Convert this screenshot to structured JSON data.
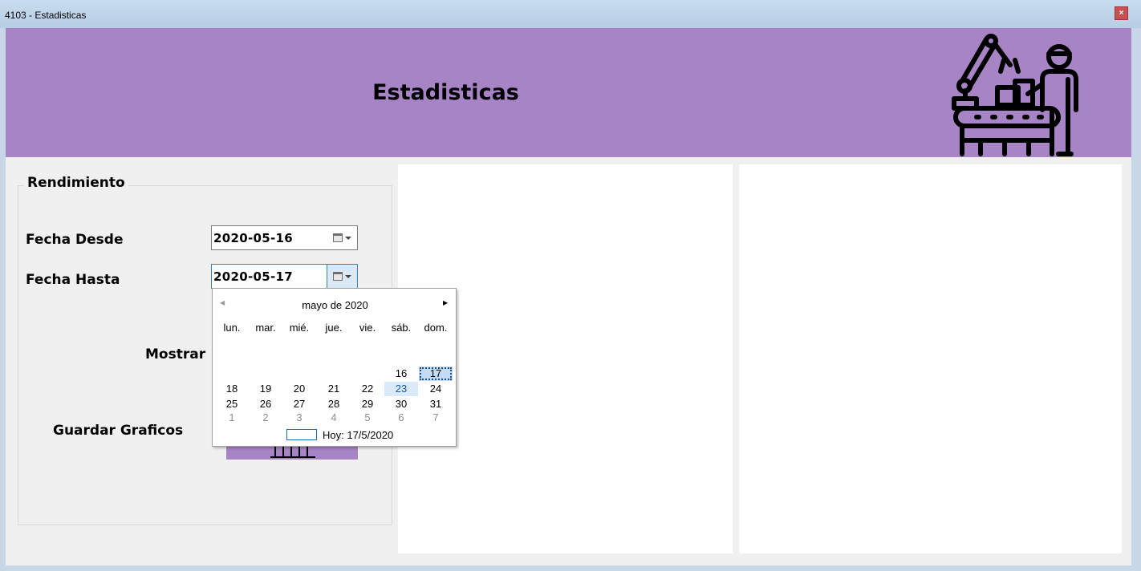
{
  "window": {
    "title": "4103 - Estadisticas",
    "close_glyph": "×",
    "close_color": "#c75050"
  },
  "header": {
    "title": "Estadisticas",
    "background": "#a684c6",
    "icon": "factory-worker-icon"
  },
  "rendimiento": {
    "title": "Rendimiento",
    "fecha_desde": {
      "label": "Fecha Desde",
      "value": "2020-05-16"
    },
    "fecha_hasta": {
      "label": "Fecha Hasta",
      "value": "2020-05-17"
    },
    "mostrar_label": "Mostrar",
    "guardar_label": "Guardar Graficos"
  },
  "calendar": {
    "month_title": "mayo de 2020",
    "prev_glyph": "◀",
    "next_glyph": "▶",
    "weekdays": [
      "lun.",
      "mar.",
      "mié.",
      "jue.",
      "vie.",
      "sáb.",
      "dom."
    ],
    "weeks": [
      [
        null,
        null,
        null,
        null,
        null,
        "16",
        "17"
      ],
      [
        "18",
        "19",
        "20",
        "21",
        "22",
        "23",
        "24"
      ],
      [
        "25",
        "26",
        "27",
        "28",
        "29",
        "30",
        "31"
      ],
      [
        "1",
        "2",
        "3",
        "4",
        "5",
        "6",
        "7"
      ]
    ],
    "selected_day": "17",
    "highlighted_day": "23",
    "today_label": "Hoy: 17/5/2020"
  }
}
